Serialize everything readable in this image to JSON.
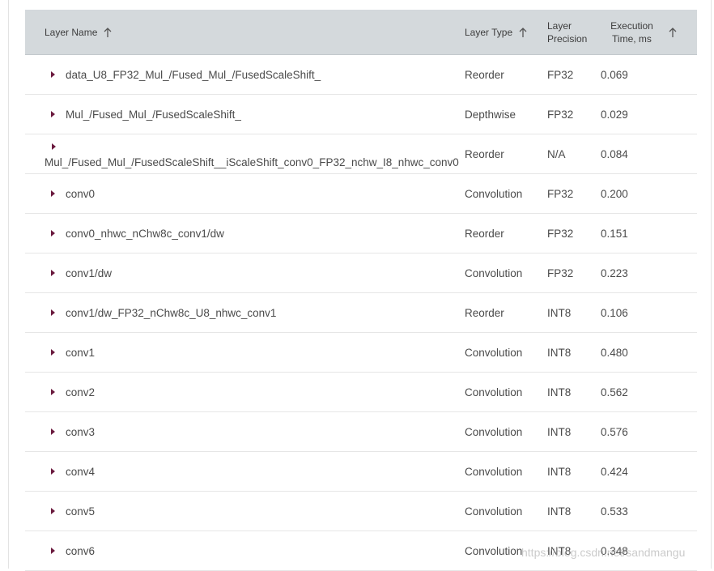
{
  "header": {
    "layer_name": "Layer Name",
    "layer_type": "Layer Type",
    "layer_precision_1": "Layer",
    "layer_precision_2": "Precision",
    "exec_time_1": "Execution",
    "exec_time_2": "Time, ms"
  },
  "rows": [
    {
      "name": "data_U8_FP32_Mul_/Fused_Mul_/FusedScaleShift_",
      "type": "Reorder",
      "precision": "FP32",
      "time": "0.069"
    },
    {
      "name": "Mul_/Fused_Mul_/FusedScaleShift_",
      "type": "Depthwise",
      "precision": "FP32",
      "time": "0.029"
    },
    {
      "name": "Mul_/Fused_Mul_/FusedScaleShift__iScaleShift_conv0_FP32_nchw_I8_nhwc_conv0",
      "type": "Reorder",
      "precision": "N/A",
      "time": "0.084"
    },
    {
      "name": "conv0",
      "type": "Convolution",
      "precision": "FP32",
      "time": "0.200"
    },
    {
      "name": "conv0_nhwc_nChw8c_conv1/dw",
      "type": "Reorder",
      "precision": "FP32",
      "time": "0.151"
    },
    {
      "name": "conv1/dw",
      "type": "Convolution",
      "precision": "FP32",
      "time": "0.223"
    },
    {
      "name": "conv1/dw_FP32_nChw8c_U8_nhwc_conv1",
      "type": "Reorder",
      "precision": "INT8",
      "time": "0.106"
    },
    {
      "name": "conv1",
      "type": "Convolution",
      "precision": "INT8",
      "time": "0.480"
    },
    {
      "name": "conv2",
      "type": "Convolution",
      "precision": "INT8",
      "time": "0.562"
    },
    {
      "name": "conv3",
      "type": "Convolution",
      "precision": "INT8",
      "time": "0.576"
    },
    {
      "name": "conv4",
      "type": "Convolution",
      "precision": "INT8",
      "time": "0.424"
    },
    {
      "name": "conv5",
      "type": "Convolution",
      "precision": "INT8",
      "time": "0.533"
    },
    {
      "name": "conv6",
      "type": "Convolution",
      "precision": "INT8",
      "time": "0.348"
    }
  ],
  "watermark": "https://blog.csdn.net/sandmangu",
  "colors": {
    "header_bg": "#d4d9dc",
    "caret": "#6b1a3e"
  }
}
